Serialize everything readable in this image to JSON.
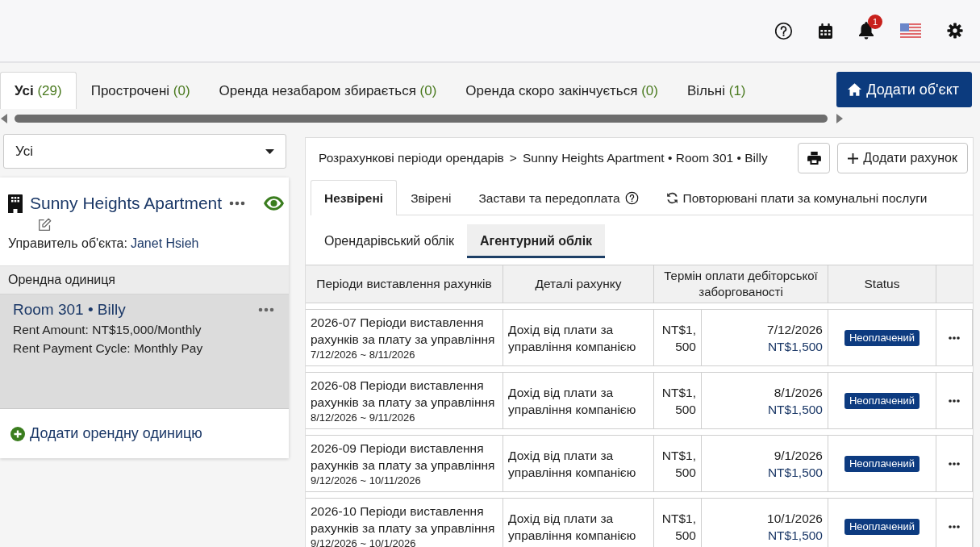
{
  "top_bar": {
    "notification_count": "1"
  },
  "tabs": [
    {
      "label": "Усі",
      "count": "(29)",
      "selected": true
    },
    {
      "label": "Прострочені",
      "count": "(0)",
      "selected": false
    },
    {
      "label": "Оренда незабаром збирається",
      "count": "(0)",
      "selected": false
    },
    {
      "label": "Оренда скоро закінчується",
      "count": "(0)",
      "selected": false
    },
    {
      "label": "Вільні",
      "count": "(1)",
      "selected": false
    }
  ],
  "add_property_button": "Додати об'єкт",
  "filter": {
    "value": "Усі"
  },
  "property": {
    "name": "Sunny Heights Apartment",
    "manager_label": "Управитель об'єкта:",
    "manager": "Janet Hsieh",
    "units_heading": "Орендна одиниця",
    "units": [
      {
        "title": "Room 301 • Billy",
        "selected": true,
        "lines": [
          "Rent Amount: NT$15,000/Monthly",
          "Rent Payment Cycle: Monthly Pay"
        ]
      }
    ],
    "add_unit": "Додати орендну одиницю"
  },
  "breadcrumb": {
    "items": [
      "Розрахункові періоди орендарів",
      "Sunny Heights Apartment • Room 301 • Billy"
    ],
    "separator": ">"
  },
  "add_bill_button": "Додати рахунок",
  "bill_tabs": [
    {
      "label": "Незвірені",
      "selected": true,
      "kind": "plain"
    },
    {
      "label": "Звірені",
      "selected": false,
      "kind": "plain"
    },
    {
      "label": "Застави та передоплата",
      "selected": false,
      "kind": "help"
    },
    {
      "label": "Повторювані плати за комунальні послуги",
      "selected": false,
      "kind": "recurring"
    }
  ],
  "ledger_tabs": [
    {
      "label": "Орендарівський облік",
      "selected": false
    },
    {
      "label": "Агентурний облік",
      "selected": true
    }
  ],
  "table": {
    "columns": [
      "Періоди виставлення рахунків",
      "Деталі рахунку",
      "Термін оплати дебіторської заборгованості",
      "Status"
    ],
    "rows": [
      {
        "period": "2026-07 Періоди виставлення рахунків за плату за управління",
        "dates": "7/12/2026 ~ 8/11/2026",
        "details": "Дохід від плати за управління компанією",
        "amount": "NT$1,500",
        "due_date": "7/12/2026",
        "due_amount": "NT$1,500",
        "status": "Неоплачений"
      },
      {
        "period": "2026-08 Періоди виставлення рахунків за плату за управління",
        "dates": "8/12/2026 ~ 9/11/2026",
        "details": "Дохід від плати за управління компанією",
        "amount": "NT$1,500",
        "due_date": "8/1/2026",
        "due_amount": "NT$1,500",
        "status": "Неоплачений"
      },
      {
        "period": "2026-09 Періоди виставлення рахунків за плату за управління",
        "dates": "9/12/2026 ~ 10/11/2026",
        "details": "Дохід від плати за управління компанією",
        "amount": "NT$1,500",
        "due_date": "9/1/2026",
        "due_amount": "NT$1,500",
        "status": "Неоплачений"
      },
      {
        "period": "2026-10 Періоди виставлення рахунків за плату за управління",
        "dates": "9/12/2026 ~ 10/1/2026",
        "details": "Дохід від плати за управління компанією",
        "amount": "NT$1,500",
        "due_date": "10/1/2026",
        "due_amount": "NT$1,500",
        "status": "Неоплачений"
      }
    ]
  }
}
